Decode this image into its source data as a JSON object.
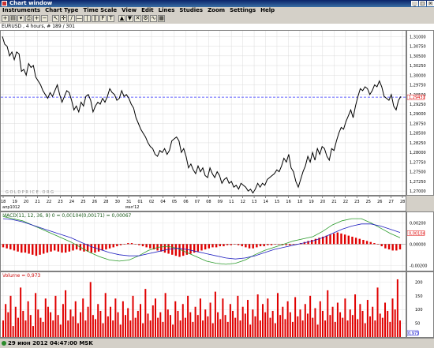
{
  "window": {
    "title": "Chart window",
    "controls": [
      "_",
      "□",
      "×"
    ]
  },
  "menu": [
    "Instruments",
    "Chart Type",
    "Time Scale",
    "View",
    "Edit",
    "Lines",
    "Studies",
    "Zoom",
    "Settings",
    "Help"
  ],
  "toolbar_icons": [
    "new-chart-icon",
    "open-icon",
    "save-icon",
    "print-icon",
    "zoom-in-icon",
    "zoom-out-icon",
    "cursor-icon",
    "crosshair-icon",
    "line-tool-icon",
    "hline-tool-icon",
    "vline-tool-icon",
    "channel-tool-icon",
    "fib-tool-icon",
    "text-tool-icon",
    "arrow-up-icon",
    "arrow-down-icon",
    "delete-icon",
    "properties-icon",
    "indicators-icon",
    "templates-icon"
  ],
  "chart_header": "EURUSD , 4 hours, # 189 / 301",
  "watermark": "G O L D P R I C E . O R G",
  "price_axis": {
    "ticks": [
      "1,31000",
      "1,30750",
      "1,30500",
      "1,30250",
      "1,30000",
      "1,29750",
      "1,29500",
      "1,29250",
      "1,29000",
      "1,28750",
      "1,28500",
      "1,28250",
      "1,28000",
      "1,27750",
      "1,27500",
      "1,27250",
      "1,27000"
    ],
    "current": "1,29431"
  },
  "date_axis": {
    "ticks": [
      "18",
      "19",
      "20",
      "21",
      "22",
      "23",
      "24",
      "25",
      "26",
      "28",
      "30",
      "31",
      "01",
      "02",
      "04",
      "05",
      "06",
      "07",
      "08",
      "09",
      "11",
      "12",
      "13",
      "14",
      "15",
      "16",
      "18",
      "19",
      "20",
      "21",
      "22",
      "23",
      "25",
      "26",
      "27",
      "28"
    ],
    "month_labels": [
      "апр1012",
      "мэл'12"
    ]
  },
  "macd": {
    "label": "MACD(11, 12, 26, 9) 0 = 0,00104(0,00171) = 0,00067",
    "ticks": [
      "0,00200",
      "0,00000",
      "-0,00200"
    ],
    "current": "0,00104"
  },
  "volume": {
    "label": "Volume = 0,973",
    "ticks": [
      "200",
      "150",
      "100",
      "50"
    ],
    "current": "0,973"
  },
  "status": {
    "text": "29 июн 2012 04:47:00 MSK"
  },
  "chart_data": [
    {
      "type": "line",
      "title": "EURUSD , 4 hours, # 189 / 301",
      "xlabel": "",
      "ylabel": "",
      "ylim": [
        1.269,
        1.3115
      ],
      "reference_line": 1.29431,
      "series": [
        {
          "values": [
            1.31,
            1.308,
            1.3075,
            1.305,
            1.306,
            1.304,
            1.306,
            1.3055,
            1.301,
            1.3015,
            1.3,
            1.303,
            1.302,
            1.3025,
            1.2995,
            1.2985,
            1.2975,
            1.296,
            1.295,
            1.294,
            1.2955,
            1.2945,
            1.296,
            1.2975,
            1.295,
            1.293,
            1.2945,
            1.296,
            1.2955,
            1.2935,
            1.291,
            1.292,
            1.2905,
            1.293,
            1.292,
            1.2945,
            1.295,
            1.2935,
            1.2905,
            1.292,
            1.293,
            1.2925,
            1.294,
            1.293,
            1.2945,
            1.2965,
            1.2955,
            1.295,
            1.2935,
            1.294,
            1.296,
            1.2945,
            1.295,
            1.294,
            1.2925,
            1.2915,
            1.289,
            1.2875,
            1.286,
            1.285,
            1.284,
            1.2825,
            1.2815,
            1.281,
            1.2795,
            1.279,
            1.2805,
            1.28,
            1.281,
            1.2795,
            1.2805,
            1.283,
            1.2835,
            1.284,
            1.283,
            1.28,
            1.281,
            1.279,
            1.276,
            1.277,
            1.2755,
            1.2745,
            1.2765,
            1.275,
            1.276,
            1.274,
            1.2735,
            1.276,
            1.2745,
            1.2735,
            1.275,
            1.274,
            1.272,
            1.273,
            1.2735,
            1.272,
            1.2725,
            1.271,
            1.2715,
            1.2705,
            1.272,
            1.2715,
            1.271,
            1.27,
            1.2705,
            1.2695,
            1.2705,
            1.272,
            1.271,
            1.272,
            1.2715,
            1.273,
            1.2735,
            1.274,
            1.2745,
            1.2755,
            1.275,
            1.2765,
            1.2785,
            1.2775,
            1.2795,
            1.276,
            1.275,
            1.2725,
            1.271,
            1.273,
            1.275,
            1.2765,
            1.279,
            1.2775,
            1.28,
            1.278,
            1.281,
            1.2795,
            1.2815,
            1.281,
            1.279,
            1.278,
            1.281,
            1.2805,
            1.283,
            1.285,
            1.2865,
            1.286,
            1.288,
            1.2895,
            1.291,
            1.289,
            1.292,
            1.2945,
            1.2965,
            1.296,
            1.297,
            1.2965,
            1.295,
            1.296,
            1.2975,
            1.297,
            1.2985,
            1.297,
            1.2945,
            1.294,
            1.2935,
            1.295,
            1.292,
            1.291,
            1.2935,
            1.2945
          ]
        }
      ]
    },
    {
      "type": "bar",
      "title": "MACD(11, 12, 26, 9) 0 = 0,00104(0,00171) = 0,00067",
      "ylim": [
        -0.0025,
        0.003
      ],
      "series": [
        {
          "values": [
            -0.0003,
            -0.0004,
            -0.0005,
            -0.0006,
            -0.0007,
            -0.0008,
            -0.0008,
            -0.0009,
            -0.001,
            -0.0011,
            -0.001,
            -0.0009,
            -0.0008,
            -0.0007,
            -0.0006,
            -0.0007,
            -0.0008,
            -0.0008,
            -0.0007,
            -0.0006,
            -0.0005,
            -0.0006,
            -0.0007,
            -0.0007,
            -0.0008,
            -0.0008,
            -0.0007,
            -0.0006,
            -0.0005,
            -0.0004,
            -0.0003,
            -0.0002,
            -0.0001,
            0.0,
            0.0001,
            0.0001,
            0.0,
            -0.0001,
            -0.0002,
            -0.0003,
            -0.0004,
            -0.0005,
            -0.0006,
            -0.0007,
            -0.0008,
            -0.0009,
            -0.001,
            -0.0011,
            -0.0012,
            -0.0011,
            -0.001,
            -0.0009,
            -0.0008,
            -0.0007,
            -0.0006,
            -0.0005,
            -0.0004,
            -0.0003,
            -0.0003,
            -0.0002,
            -0.0002,
            -0.0001,
            -0.0001,
            0.0,
            -0.0001,
            -0.0002,
            -0.0003,
            -0.0004,
            -0.0004,
            -0.0003,
            -0.0002,
            -0.0002,
            -0.0001,
            -0.0001,
            0.0,
            0.0,
            -0.0001,
            -0.0001,
            -0.0001,
            0.0,
            0.0,
            0.0001,
            0.0002,
            0.0003,
            0.0004,
            0.0005,
            0.0006,
            0.0007,
            0.0008,
            0.0009,
            0.001,
            0.0011,
            0.001,
            0.0009,
            0.0008,
            0.0007,
            0.0006,
            0.0005,
            0.0004,
            0.0003,
            0.0002,
            0.0001,
            0.0,
            -0.0002,
            -0.0004,
            -0.0005,
            -0.0006,
            -0.0006,
            -0.0005
          ]
        },
        {
          "values": [
            0.0026,
            0.0024,
            0.0022,
            0.0018,
            0.0014,
            0.001,
            0.0006,
            0.0002,
            -0.0003,
            -0.0008,
            -0.0012,
            -0.0015,
            -0.0016,
            -0.0015,
            -0.0011,
            -0.0006,
            -0.0003,
            -0.0002,
            -0.0004,
            -0.0008,
            -0.0012,
            -0.0016,
            -0.0018,
            -0.0019,
            -0.0018,
            -0.0015,
            -0.001,
            -0.0006,
            -0.0003,
            0.0,
            0.0003,
            0.0005,
            0.0007,
            0.0012,
            0.0018,
            0.0022,
            0.0024,
            0.0024,
            0.002,
            0.0015,
            0.001,
            0.0006
          ]
        },
        {
          "values": [
            0.0024,
            0.0023,
            0.0021,
            0.0018,
            0.0015,
            0.0012,
            0.0009,
            0.0006,
            0.0002,
            -0.0002,
            -0.0005,
            -0.0008,
            -0.001,
            -0.0011,
            -0.0011,
            -0.0009,
            -0.0007,
            -0.0005,
            -0.0004,
            -0.0005,
            -0.0007,
            -0.0009,
            -0.0011,
            -0.0013,
            -0.0014,
            -0.0013,
            -0.0011,
            -0.0008,
            -0.0005,
            -0.0003,
            -0.0001,
            0.0001,
            0.0003,
            0.0006,
            0.001,
            0.0014,
            0.0017,
            0.0019,
            0.0019,
            0.0017,
            0.0014,
            0.0011
          ]
        }
      ]
    },
    {
      "type": "bar",
      "title": "Volume = 0,973",
      "ylim": [
        0,
        230
      ],
      "series": [
        {
          "values": [
            60,
            120,
            90,
            150,
            40,
            110,
            70,
            180,
            95,
            60,
            130,
            80,
            40,
            160,
            100,
            70,
            55,
            140,
            110,
            90,
            60,
            150,
            80,
            45,
            120,
            170,
            60,
            100,
            75,
            130,
            50,
            90,
            140,
            60,
            110,
            200,
            80,
            65,
            120,
            95,
            50,
            160,
            75,
            110,
            60,
            140,
            90,
            45,
            130,
            80,
            105,
            60,
            150,
            70,
            95,
            120,
            50,
            175,
            85,
            60,
            115,
            140,
            70,
            90,
            55,
            160,
            100,
            80,
            45,
            130,
            95,
            60,
            120,
            70,
            150,
            90,
            55,
            110,
            80,
            140,
            60,
            100,
            75,
            125,
            50,
            165,
            90,
            65,
            140,
            80,
            55,
            120,
            95,
            70,
            150,
            60,
            110,
            85,
            135,
            45,
            100,
            75,
            155,
            60,
            120,
            90,
            140,
            70,
            95,
            50,
            160,
            80,
            110,
            65,
            130,
            90,
            55,
            145,
            75,
            100,
            60,
            120,
            85,
            150,
            70,
            105,
            45,
            130,
            95,
            60,
            170,
            80,
            110,
            55,
            125,
            90,
            70,
            140,
            60,
            100,
            80,
            155,
            65,
            120,
            95,
            50,
            135,
            75,
            110,
            60,
            180,
            85,
            70,
            125,
            95,
            55,
            140,
            100,
            210,
            60
          ]
        }
      ]
    }
  ]
}
